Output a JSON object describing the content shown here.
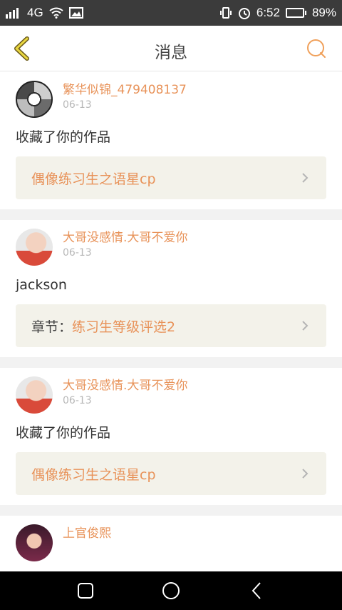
{
  "status_bar": {
    "signal": "4G",
    "time": "6:52",
    "battery": "89%",
    "battery_level": 0.89
  },
  "header": {
    "title": "消息",
    "back_icon": "chevron-left-icon",
    "search_icon": "search-icon"
  },
  "colors": {
    "accent": "#e8935a",
    "back_accent": "#d4c23a",
    "link_bg": "#f3f2ea"
  },
  "notifications": [
    {
      "name": "繁华似锦_479408137",
      "date": "06-13",
      "message": "收藏了你的作品",
      "link_prefix": "",
      "link": "偶像练习生之语星cp"
    },
    {
      "name": "大哥没感情.大哥不爱你",
      "date": "06-13",
      "message": "jackson",
      "link_prefix": "章节：",
      "link": "练习生等级评选2"
    },
    {
      "name": "大哥没感情.大哥不爱你",
      "date": "06-13",
      "message": "收藏了你的作品",
      "link_prefix": "",
      "link": "偶像练习生之语星cp"
    },
    {
      "name": "上官俊熙",
      "date": "",
      "message": "",
      "link_prefix": "",
      "link": ""
    }
  ],
  "nav": {
    "recent_icon": "square-icon",
    "home_icon": "circle-icon",
    "back_icon": "triangle-back-icon"
  }
}
